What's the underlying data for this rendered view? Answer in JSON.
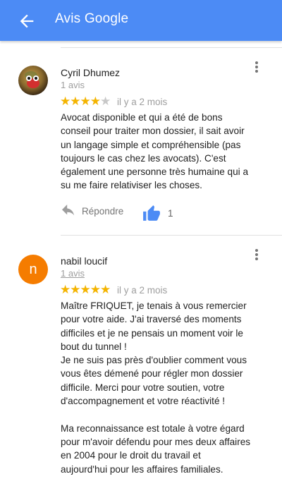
{
  "header": {
    "title": "Avis Google",
    "back_icon": "arrow-left-icon",
    "bg_color": "#4c8bf5"
  },
  "reviews": [
    {
      "author": "Cyril Dhumez",
      "review_count": "1 avis",
      "rating": 4,
      "rating_max": 5,
      "date": "il y a 2 mois",
      "text": "Avocat disponible et qui a été de bons\nconseil pour traiter mon dossier, il sait avoir\nun langage simple et compréhensible (pas\ntoujours le cas chez les avocats). C'est\négalement une personne très humaine qui a\nsu me faire relativiser les choses.",
      "reply_label": "Répondre",
      "likes": "1",
      "avatar": "photo"
    },
    {
      "author": "nabil loucif",
      "review_count": "1 avis",
      "rating": 5,
      "rating_max": 5,
      "date": "il y a 2 mois",
      "text": "Maître FRIQUET, je tenais à vous remercier\npour votre aide. J'ai traversé des moments\ndifficiles et je ne pensais un moment voir le\nbout du tunnel !\nJe ne suis pas près d'oublier comment vous\nvous êtes  démené pour régler mon dossier\ndifficile. Merci pour votre soutien, votre\nd'accompagnement et votre réactivité !\n\nMa reconnaissance est totale à votre égard\npour m'avoir défendu pour mes deux affaires\nen 2004 pour le droit du travail et\naujourd'hui pour les affaires familiales.",
      "avatar_letter": "n",
      "avatar_color": "#f57c00"
    }
  ],
  "colors": {
    "star": "#f4b400",
    "like": "#4c8bf5"
  }
}
